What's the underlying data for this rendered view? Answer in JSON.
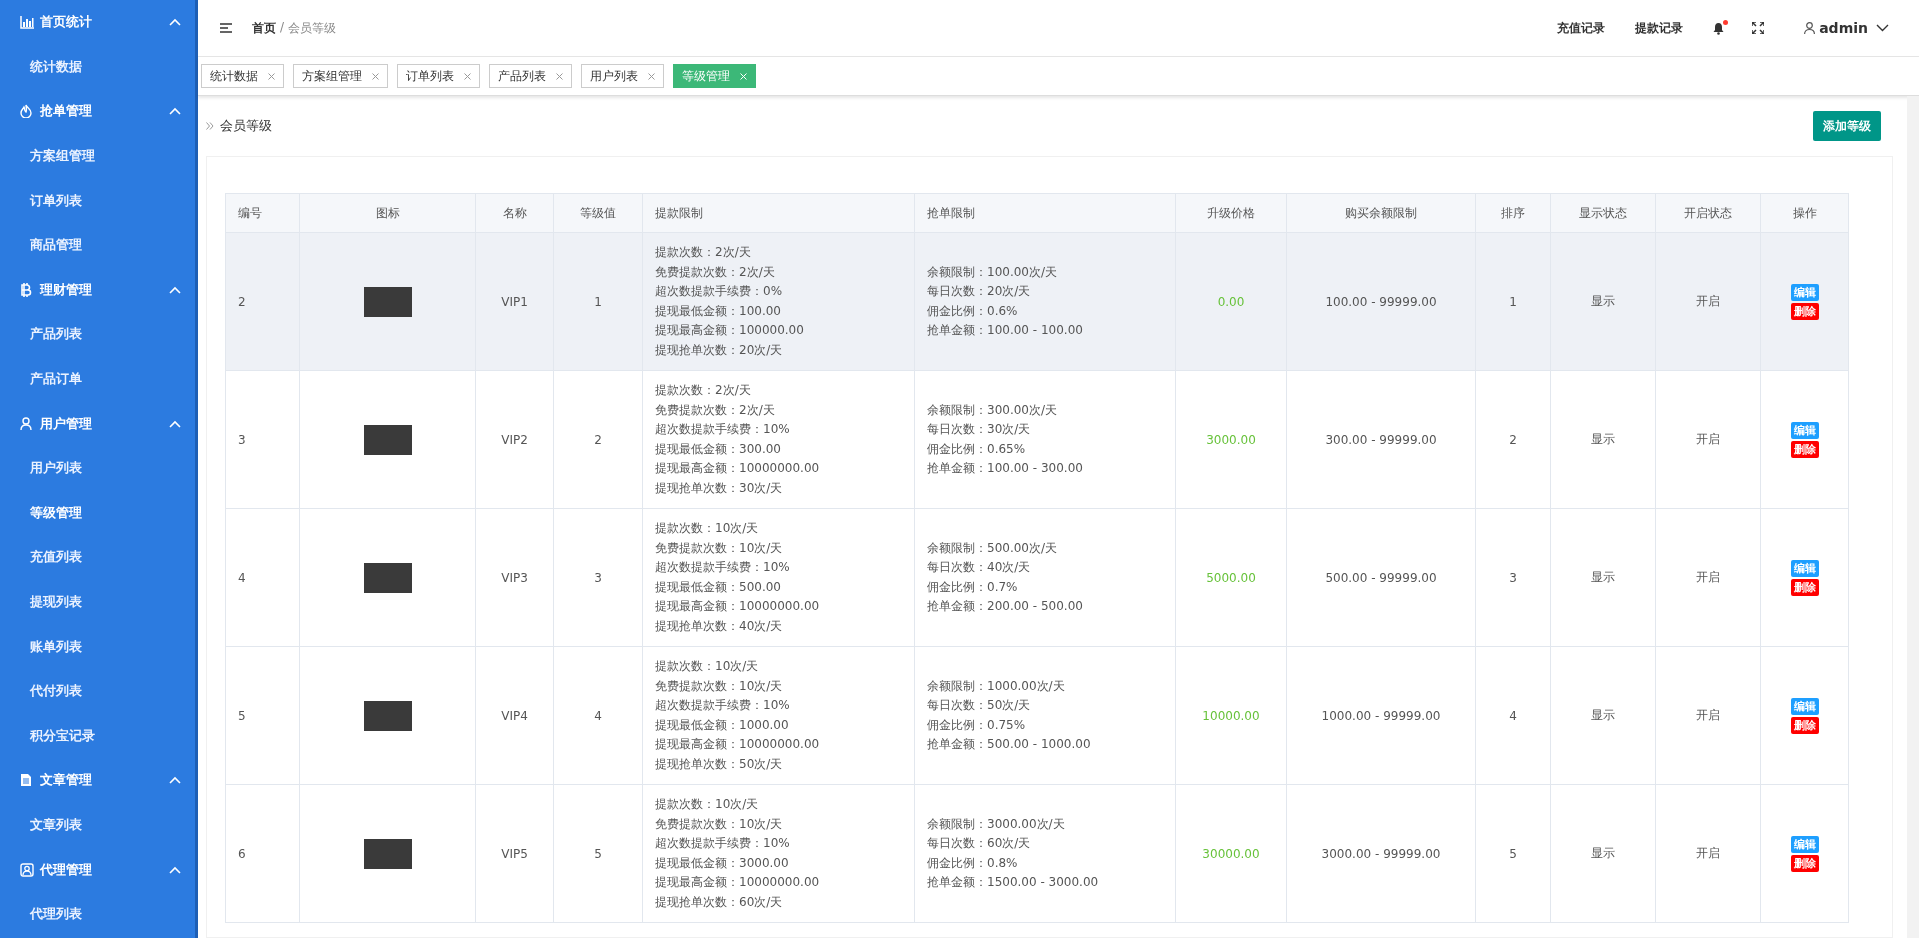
{
  "sidebar": {
    "groups": [
      {
        "kind": "chart",
        "label": "首页统计",
        "expanded": true,
        "children": [
          {
            "label": "统计数据",
            "selected": false
          }
        ]
      },
      {
        "kind": "flame",
        "label": "抢单管理",
        "expanded": true,
        "children": [
          {
            "label": "方案组管理",
            "selected": false
          },
          {
            "label": "订单列表",
            "selected": false
          },
          {
            "label": "商品管理",
            "selected": false
          }
        ]
      },
      {
        "kind": "coin",
        "label": "理财管理",
        "expanded": true,
        "children": [
          {
            "label": "产品列表",
            "selected": false
          },
          {
            "label": "产品订单",
            "selected": false
          }
        ]
      },
      {
        "kind": "user",
        "label": "用户管理",
        "expanded": true,
        "children": [
          {
            "label": "用户列表",
            "selected": false
          },
          {
            "label": "等级管理",
            "selected": true
          },
          {
            "label": "充值列表",
            "selected": false
          },
          {
            "label": "提现列表",
            "selected": false
          },
          {
            "label": "账单列表",
            "selected": false
          },
          {
            "label": "代付列表",
            "selected": false
          },
          {
            "label": "积分宝记录",
            "selected": false
          }
        ]
      },
      {
        "kind": "doc",
        "label": "文章管理",
        "expanded": true,
        "children": [
          {
            "label": "文章列表",
            "selected": false
          }
        ]
      },
      {
        "kind": "agent",
        "label": "代理管理",
        "expanded": true,
        "children": [
          {
            "label": "代理列表",
            "selected": false
          }
        ]
      }
    ]
  },
  "header": {
    "breadcrumb": [
      "首页",
      "/",
      "会员等级"
    ],
    "links": [
      "充值记录",
      "提款记录"
    ],
    "notification_dot": true,
    "user": "admin"
  },
  "tabs": [
    {
      "label": "统计数据",
      "selected": false
    },
    {
      "label": "方案组管理",
      "selected": false
    },
    {
      "label": "订单列表",
      "selected": false
    },
    {
      "label": "产品列表",
      "selected": false
    },
    {
      "label": "用户列表",
      "selected": false
    },
    {
      "label": "等级管理",
      "selected": true
    }
  ],
  "panel": {
    "title": "会员等级",
    "add_button": "添加等级"
  },
  "table": {
    "columns": [
      "编号",
      "图标",
      "名称",
      "等级值",
      "提款限制",
      "抢单限制",
      "升级价格",
      "购买余额限制",
      "排序",
      "显示状态",
      "开启状态",
      "操作"
    ],
    "rows": [
      {
        "hovered": true,
        "id": "2",
        "name": "VIP1",
        "level_value": "1",
        "withdraw_limits": [
          "提款次数：2次/天",
          "免费提款次数：2次/天",
          "超次数提款手续费：0%",
          "提现最低金额：100.00",
          "提现最高金额：100000.00",
          "提现抢单次数：20次/天"
        ],
        "grab_limits": [
          "余额限制：100.00次/天",
          "每日次数：20次/天",
          "佣金比例：0.6%",
          "抢单金额：100.00 - 100.00"
        ],
        "upgrade_price": "0.00",
        "buy_balance_limit": "100.00 - 99999.00",
        "sort": "1",
        "display_status": "显示",
        "open_status": "开启",
        "actions": [
          {
            "kind": "edit",
            "label": "编辑"
          },
          {
            "kind": "delete",
            "label": "删除"
          }
        ]
      },
      {
        "hovered": false,
        "id": "3",
        "name": "VIP2",
        "level_value": "2",
        "withdraw_limits": [
          "提款次数：2次/天",
          "免费提款次数：2次/天",
          "超次数提款手续费：10%",
          "提现最低金额：300.00",
          "提现最高金额：10000000.00",
          "提现抢单次数：30次/天"
        ],
        "grab_limits": [
          "余额限制：300.00次/天",
          "每日次数：30次/天",
          "佣金比例：0.65%",
          "抢单金额：100.00 - 300.00"
        ],
        "upgrade_price": "3000.00",
        "buy_balance_limit": "300.00 - 99999.00",
        "sort": "2",
        "display_status": "显示",
        "open_status": "开启",
        "actions": [
          {
            "kind": "edit",
            "label": "编辑"
          },
          {
            "kind": "delete",
            "label": "删除"
          }
        ]
      },
      {
        "hovered": false,
        "id": "4",
        "name": "VIP3",
        "level_value": "3",
        "withdraw_limits": [
          "提款次数：10次/天",
          "免费提款次数：10次/天",
          "超次数提款手续费：10%",
          "提现最低金额：500.00",
          "提现最高金额：10000000.00",
          "提现抢单次数：40次/天"
        ],
        "grab_limits": [
          "余额限制：500.00次/天",
          "每日次数：40次/天",
          "佣金比例：0.7%",
          "抢单金额：200.00 - 500.00"
        ],
        "upgrade_price": "5000.00",
        "buy_balance_limit": "500.00 - 99999.00",
        "sort": "3",
        "display_status": "显示",
        "open_status": "开启",
        "actions": [
          {
            "kind": "edit",
            "label": "编辑"
          },
          {
            "kind": "delete",
            "label": "删除"
          }
        ]
      },
      {
        "hovered": false,
        "id": "5",
        "name": "VIP4",
        "level_value": "4",
        "withdraw_limits": [
          "提款次数：10次/天",
          "免费提款次数：10次/天",
          "超次数提款手续费：10%",
          "提现最低金额：1000.00",
          "提现最高金额：10000000.00",
          "提现抢单次数：50次/天"
        ],
        "grab_limits": [
          "余额限制：1000.00次/天",
          "每日次数：50次/天",
          "佣金比例：0.75%",
          "抢单金额：500.00 - 1000.00"
        ],
        "upgrade_price": "10000.00",
        "buy_balance_limit": "1000.00 - 99999.00",
        "sort": "4",
        "display_status": "显示",
        "open_status": "开启",
        "actions": [
          {
            "kind": "edit",
            "label": "编辑"
          },
          {
            "kind": "delete",
            "label": "删除"
          }
        ]
      },
      {
        "hovered": false,
        "id": "6",
        "name": "VIP5",
        "level_value": "5",
        "withdraw_limits": [
          "提款次数：10次/天",
          "免费提款次数：10次/天",
          "超次数提款手续费：10%",
          "提现最低金额：3000.00",
          "提现最高金额：10000000.00",
          "提现抢单次数：60次/天"
        ],
        "grab_limits": [
          "余额限制：3000.00次/天",
          "每日次数：60次/天",
          "佣金比例：0.8%",
          "抢单金额：1500.00 - 3000.00"
        ],
        "upgrade_price": "30000.00",
        "buy_balance_limit": "3000.00 - 99999.00",
        "sort": "5",
        "display_status": "显示",
        "open_status": "开启",
        "actions": [
          {
            "kind": "edit",
            "label": "编辑"
          },
          {
            "kind": "delete",
            "label": "删除"
          }
        ]
      }
    ]
  }
}
